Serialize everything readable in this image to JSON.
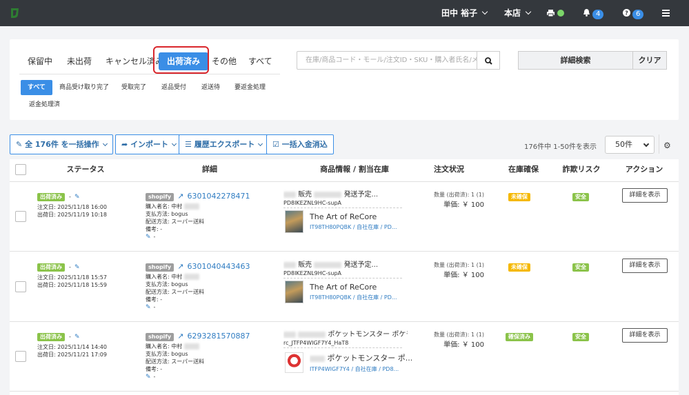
{
  "topbar": {
    "user": "田中 裕子",
    "store": "本店",
    "bell_count": "4",
    "help_count": "6"
  },
  "tabs": [
    {
      "label": "保留中"
    },
    {
      "label": "未出荷"
    },
    {
      "label": "キャンセル済み"
    },
    {
      "label": "出荷済み"
    },
    {
      "label": "その他"
    },
    {
      "label": "すべて"
    }
  ],
  "subtabs": [
    {
      "label": "すべて"
    },
    {
      "label": "商品受け取り完了"
    },
    {
      "label": "受取完了"
    },
    {
      "label": "返品受付"
    },
    {
      "label": "返送待"
    },
    {
      "label": "要返金処理"
    },
    {
      "label": "返金処理済"
    }
  ],
  "search": {
    "placeholder": "在庫/商品コード・モール/注文ID・SKU・購入者氏名/メ"
  },
  "buttons": {
    "detail_search": "詳細検索",
    "clear": "クリア",
    "bulk": "全 176件 を一括操作",
    "import": "インポート",
    "export": "履歴エクスポート",
    "payment": "一括入金消込"
  },
  "pagination": {
    "summary": "176件中 1-50件を表示",
    "per_page": "50件"
  },
  "columns": {
    "status": "ステータス",
    "detail": "詳細",
    "product": "商品情報 / 割当在庫",
    "order_status": "注文状況",
    "stock": "在庫確保",
    "fraud": "詐欺リスク",
    "action": "アクション"
  },
  "rows": [
    {
      "status": "出荷済み",
      "order_date": "注文日: 2025/11/18 16:00",
      "ship_date": "出荷日: 2025/11/19 10:18",
      "mall": "shopify",
      "order_id": "6301042278471",
      "buyer": "購入者名: 中村",
      "payment": "支払方法: bogus",
      "delivery": "配送方法: スーパー送料",
      "note": "備考: -",
      "edit": "-",
      "prod_title_a": "販売",
      "prod_title_b": "発送予定...",
      "sku": "PD8IKEZNL9HC-supA",
      "item_name": "The Art of ReCore",
      "item_sub": "IT98TH80PQBK / 自社在庫 / PD...",
      "qty": "数量 (出荷済): 1 (1)",
      "price": "単価: ￥ 100",
      "stock": "未確保",
      "fraud": "安全",
      "action": "詳細を表示"
    },
    {
      "status": "出荷済み",
      "order_date": "注文日: 2025/11/18 15:57",
      "ship_date": "出荷日: 2025/11/18 15:59",
      "mall": "shopify",
      "order_id": "6301040443463",
      "buyer": "購入者名: 中村",
      "payment": "支払方法: bogus",
      "delivery": "配送方法: スーパー送料",
      "note": "備考: -",
      "edit": "-",
      "prod_title_a": "販売",
      "prod_title_b": "発送予定...",
      "sku": "PD8IKEZNL9HC-supA",
      "item_name": "The Art of ReCore",
      "item_sub": "IT98TH80PQBK / 自社在庫 / PD...",
      "qty": "数量 (出荷済): 1 (1)",
      "price": "単価: ￥ 100",
      "stock": "未確保",
      "fraud": "安全",
      "action": "詳細を表示"
    },
    {
      "status": "出荷済み",
      "order_date": "注文日: 2025/11/14 14:40",
      "ship_date": "出荷日: 2025/11/21 17:09",
      "mall": "shopify",
      "order_id": "6293281570887",
      "buyer": "購入者名: 中村",
      "payment": "支払方法: bogus",
      "delivery": "配送方法: スーパー送料",
      "note": "備考: -",
      "edit": "-",
      "prod_title_a": "",
      "prod_title_b": "ポケットモンスター ポケモン ク...",
      "sku": "rc_JTFP4WIGF7Y4_HaT8",
      "item_name": "ポケットモンスター ポ...",
      "item_sub": "ITFP4WIGF7Y4 / 自社在庫 / PD8...",
      "qty": "数量 (出荷済): 1 (1)",
      "price": "単価: ￥ 100",
      "stock": "確保済み",
      "fraud": "安全",
      "action": "詳細を表示"
    }
  ]
}
